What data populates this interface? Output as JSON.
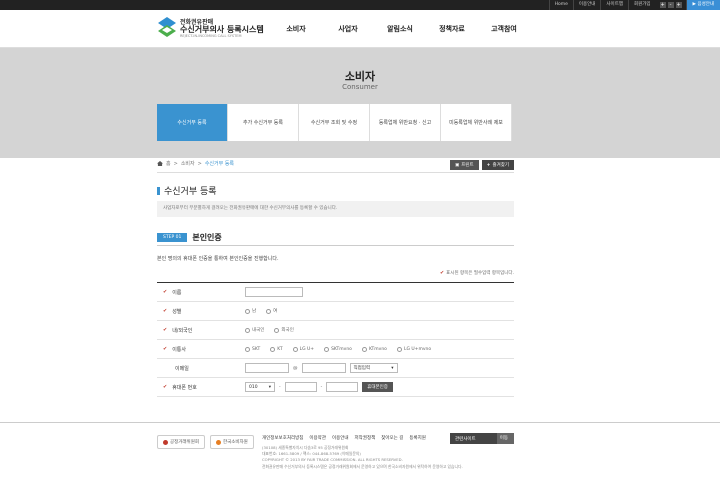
{
  "topbar": {
    "links": [
      "Home",
      "이용안내",
      "사이트맵",
      "회원가입"
    ],
    "zoom": [
      "+",
      "-",
      "+"
    ],
    "tts": "▶ 음성안내"
  },
  "header": {
    "logo_line1": "전화권유판매",
    "logo_line2": "수신거부의사 등록시스템",
    "logo_line3": "REJECT-IN-INCOMING CALL SYSTEM",
    "nav": [
      "소비자",
      "사업자",
      "알림소식",
      "정책자료",
      "고객참여"
    ]
  },
  "hero": {
    "title": "소비자",
    "subtitle": "Consumer"
  },
  "subnav": [
    "수신거부 등록",
    "추가 수신거부 등록",
    "수신거부 조회 및 수정",
    "등록업체 위반요청 · 신고",
    "미등록업체 위반사례 제보"
  ],
  "breadcrumb": [
    "홈",
    "소비자",
    "수신거부 등록"
  ],
  "actions": {
    "print": "프린트",
    "favorite": "즐겨찾기"
  },
  "page_title": "수신거부 등록",
  "notice": "사업자로부터 무분별하게 걸려오는 전화권유판매에 대한 수신거부의사를 등록할 수 있습니다.",
  "step": {
    "badge": "STEP 01",
    "title": "본인인증"
  },
  "description": "본인 명의의 휴대폰 인증을 통하여 본인인증을 진행합니다.",
  "required_note": "표시된 항목은 필수입력 항목입니다.",
  "form": {
    "name_label": "이름",
    "gender_label": "성별",
    "gender_options": [
      "남",
      "여"
    ],
    "nationality_label": "내/외국인",
    "nationality_options": [
      "내국인",
      "외국인"
    ],
    "carrier_label": "이통사",
    "carrier_options": [
      "SKT",
      "KT",
      "LG U+",
      "SKTmvno",
      "KTmvno",
      "LG U+mvno"
    ],
    "email_label": "이메일",
    "email_at": "@",
    "email_domain_select": "직접입력",
    "phone_label": "휴대폰 번호",
    "phone_prefix": "010",
    "phone_sep": "-",
    "auth_button": "휴대폰인증"
  },
  "footer": {
    "logo1": "공정거래위원회",
    "logo2": "한국소비자원",
    "links": [
      "개인정보보호처리방침",
      "이용약관",
      "이용안내",
      "저작권정책",
      "찾아오는 길",
      "등록지원"
    ],
    "address": [
      "(30108) 세종특별자치시 다솜3로 95 공정거래위원회",
      "대표번호: 1661-5809 / 팩스: 044-868-5769 (이메일문의)",
      "COPYRIGHT © 2013 BY FAIR TRADE COMMISSION. ALL RIGHTS RESERVED.",
      "전화권유판매 수신거부의사 등록시스템은 공정거래위원회에서 운영하고 있으며 한국소비자원에서 위탁하여 운영하고 있습니다."
    ],
    "related_sites": "관련사이트",
    "go": "이동"
  },
  "colors": {
    "accent": "#3a93d0",
    "topbar": "#222222",
    "hero_bg": "#d4d4d4",
    "required": "#c0392b"
  }
}
